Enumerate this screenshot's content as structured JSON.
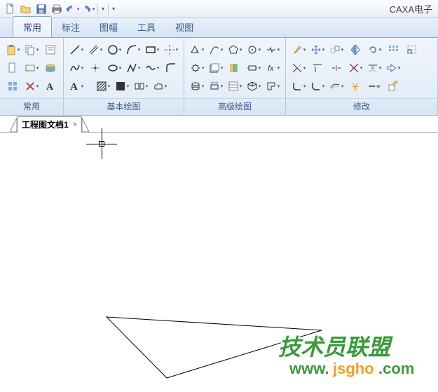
{
  "app_title": "CAXA电子",
  "tabs": {
    "changyong": "常用",
    "biaozhu": "标注",
    "tufu": "图幅",
    "gongju": "工具",
    "shitu": "视图"
  },
  "ribbon_groups": {
    "changyong": "常用",
    "jiben": "基本绘图",
    "gaoji": "高级绘图",
    "xiugai": "修改"
  },
  "doc_tab": "工程图文档1",
  "watermark": {
    "line1": "技术员联盟",
    "line2": "www.",
    "line3": "jsgho",
    "line4": ".com"
  }
}
